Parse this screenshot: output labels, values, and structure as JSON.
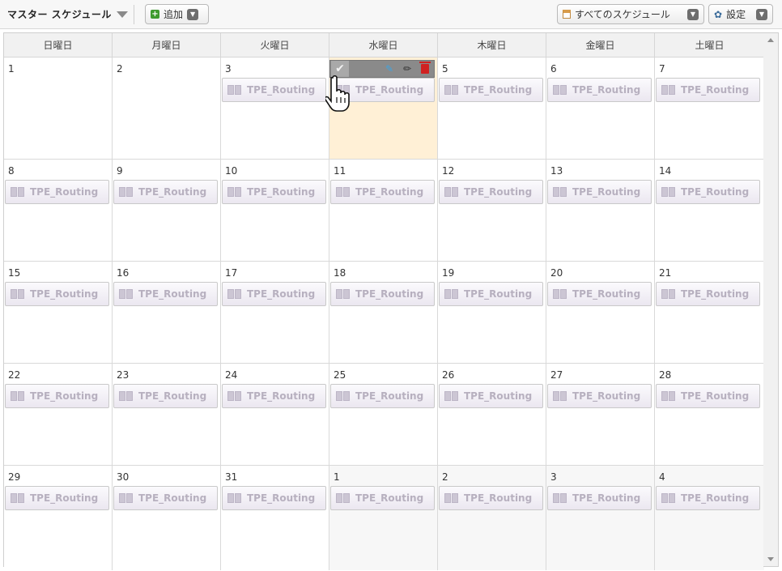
{
  "toolbar": {
    "title": "マスター スケジュール",
    "add_label": "追加",
    "filter_label": "すべてのスケジュール",
    "settings_label": "設定"
  },
  "weekdays": [
    "日曜日",
    "月曜日",
    "火曜日",
    "水曜日",
    "木曜日",
    "金曜日",
    "土曜日"
  ],
  "event_label": "TPE_Routing",
  "weeks": [
    [
      {
        "day": "1",
        "event": false,
        "other": false
      },
      {
        "day": "2",
        "event": false,
        "other": false
      },
      {
        "day": "3",
        "event": true,
        "other": false
      },
      {
        "day": "",
        "event": true,
        "other": false,
        "selected": true
      },
      {
        "day": "5",
        "event": true,
        "other": false
      },
      {
        "day": "6",
        "event": true,
        "other": false
      },
      {
        "day": "7",
        "event": true,
        "other": false
      }
    ],
    [
      {
        "day": "8",
        "event": true,
        "other": false
      },
      {
        "day": "9",
        "event": true,
        "other": false
      },
      {
        "day": "10",
        "event": true,
        "other": false
      },
      {
        "day": "11",
        "event": true,
        "other": false
      },
      {
        "day": "12",
        "event": true,
        "other": false
      },
      {
        "day": "13",
        "event": true,
        "other": false
      },
      {
        "day": "14",
        "event": true,
        "other": false
      }
    ],
    [
      {
        "day": "15",
        "event": true,
        "other": false
      },
      {
        "day": "16",
        "event": true,
        "other": false
      },
      {
        "day": "17",
        "event": true,
        "other": false
      },
      {
        "day": "18",
        "event": true,
        "other": false
      },
      {
        "day": "19",
        "event": true,
        "other": false
      },
      {
        "day": "20",
        "event": true,
        "other": false
      },
      {
        "day": "21",
        "event": true,
        "other": false
      }
    ],
    [
      {
        "day": "22",
        "event": true,
        "other": false
      },
      {
        "day": "23",
        "event": true,
        "other": false
      },
      {
        "day": "24",
        "event": true,
        "other": false
      },
      {
        "day": "25",
        "event": true,
        "other": false
      },
      {
        "day": "26",
        "event": true,
        "other": false
      },
      {
        "day": "27",
        "event": true,
        "other": false
      },
      {
        "day": "28",
        "event": true,
        "other": false
      }
    ],
    [
      {
        "day": "29",
        "event": true,
        "other": false
      },
      {
        "day": "30",
        "event": true,
        "other": false
      },
      {
        "day": "31",
        "event": true,
        "other": false
      },
      {
        "day": "1",
        "event": true,
        "other": true
      },
      {
        "day": "2",
        "event": true,
        "other": true
      },
      {
        "day": "3",
        "event": true,
        "other": true
      },
      {
        "day": "4",
        "event": true,
        "other": true
      }
    ]
  ],
  "icons": {
    "add": "plus-icon",
    "dropdown": "chevron-down-icon",
    "filter": "calendar-icon",
    "settings": "gear-icon",
    "event": "task-icon",
    "hover_actions": [
      "check-icon",
      "pin-icon",
      "pencil-icon",
      "trash-icon"
    ]
  },
  "colors": {
    "selected_cell": "#fff0d6",
    "event_text": "#b7b0bf",
    "delete": "#d02121",
    "pin": "#3fa4e0"
  }
}
